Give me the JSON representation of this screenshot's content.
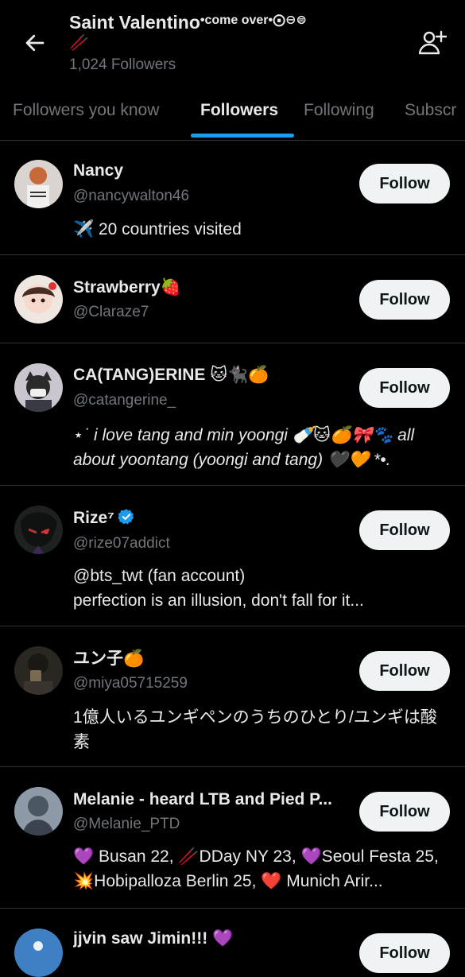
{
  "header": {
    "back_icon": "arrow-left-icon",
    "title": "Saint Valentino",
    "title_suffix": "•come over•⨀⊖⊜",
    "title_emoji": "🥢",
    "followers_count": "1,024 Followers",
    "add_user_icon": "person-add-icon"
  },
  "tabs": [
    {
      "label": "Followers you know",
      "active": false
    },
    {
      "label": "Followers",
      "active": true
    },
    {
      "label": "Following",
      "active": false
    },
    {
      "label": "Subscr",
      "active": false
    }
  ],
  "colors": {
    "background": "#000000",
    "text": "#e7e9ea",
    "secondary_text": "#71767b",
    "accent": "#1d9bf0",
    "button_bg": "#eff3f4",
    "divider": "#2f3336"
  },
  "follow_label": "Follow",
  "users": [
    {
      "name": "Nancy",
      "handle": "@nancywalton46",
      "bio": "✈️ 20 countries visited"
    },
    {
      "name": "Strawberry🍓",
      "handle": "@Claraze7",
      "bio": ""
    },
    {
      "name": "CA(TANG)ERINE 🐱🐈‍⬛🍊",
      "handle": "@catangerine_",
      "bio": "⋆˙ i love tang and min yoongi 🍼🐱🍊🎀🐾 all about yoontang (yoongi and tang) 🖤🧡 *•."
    },
    {
      "name": "Rize⁷",
      "handle": "@rize07addict",
      "bio": "@bts_twt (fan account)\nperfection is an illusion, don't fall for it...",
      "verified": true
    },
    {
      "name": "ユン子🍊",
      "handle": "@miya05715259",
      "bio": "1億人いるユンギペンのうちのひとり/ユンギは酸素"
    },
    {
      "name": "Melanie - heard LTB and Pied P...",
      "handle": "@Melanie_PTD",
      "bio": "💜 Busan 22, 🥢DDay NY 23, 💜Seoul Festa 25, 💥Hobipalloza Berlin 25, ❤️ Munich Arir..."
    },
    {
      "name": "jjvin saw Jimin!!! 💜",
      "handle": "",
      "bio": ""
    }
  ]
}
